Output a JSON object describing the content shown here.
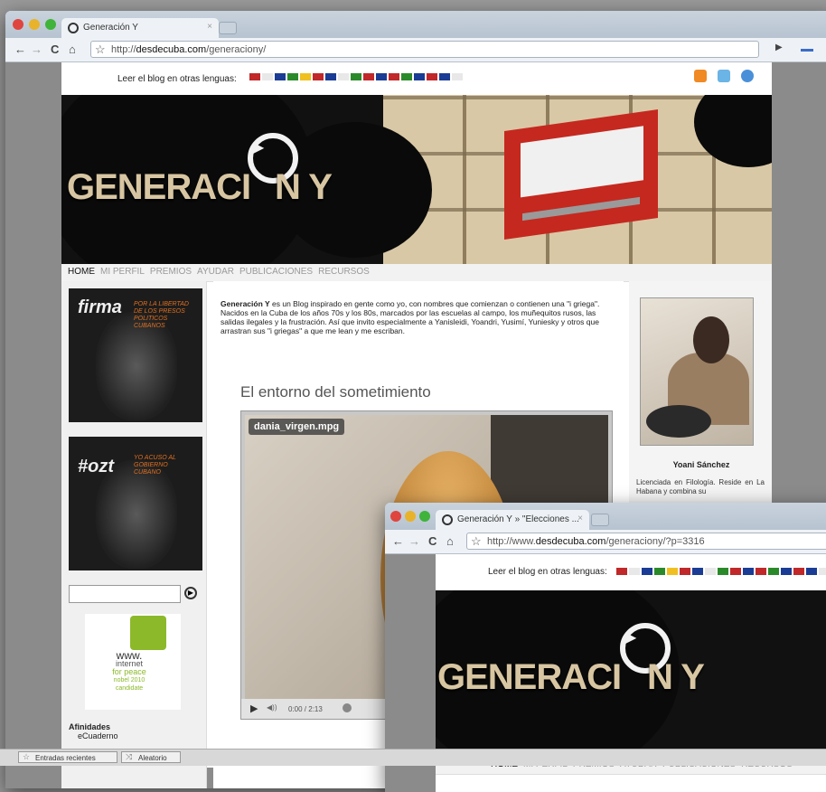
{
  "window1": {
    "tab_title": "Generación Y",
    "tab_close": "×",
    "url_plain": "http://",
    "url_host": "desdecuba.com",
    "url_path": "/generaciony/",
    "nav_back": "←",
    "nav_forward": "→",
    "nav_reload": "C",
    "nav_home": "⌂",
    "go": "▶"
  },
  "site": {
    "lang_label": "Leer el blog en otras lenguas:",
    "flags": [
      "#c0282a",
      "#e8e8e8",
      "#1a3c94",
      "#2a8a2a",
      "#f0c020",
      "#c0282a",
      "#1a3c94",
      "#e8e8e8",
      "#2a8a2a",
      "#c0282a",
      "#1a3c94",
      "#c0282a",
      "#2a8a2a",
      "#1a3c94",
      "#c0282a",
      "#1a3c94",
      "#e8e8e8"
    ],
    "logo_text_a": "GENERACI",
    "logo_text_b": "N Y",
    "nav": [
      "HOME",
      "MI PERFIL",
      "PREMIOS",
      "AYUDAR",
      "PUBLICACIONES",
      "RECURSOS"
    ],
    "campaign1_big": "firma",
    "campaign1_small": "POR LA LIBERTAD DE LOS PRESOS POLITICOS CUBANOS",
    "campaign2_big": "#ozt",
    "campaign2_small": "YO ACUSO AL GOBIERNO CUBANO",
    "peace_www": "www.",
    "peace_line1": "internet",
    "peace_line2": "for peace",
    "peace_line3": "nobel 2010",
    "peace_line4": "candidate",
    "afinidades_title": "Afinidades",
    "afinidades_item": "eCuaderno",
    "intro_bold": "Generación Y",
    "intro_text": " es un Blog inspirado en gente como yo, con nombres que comienzan o contienen una \"i griega\". Nacidos en la Cuba de los años 70s y los 80s, marcados por las escuelas al campo, los muñequitos rusos, las salidas ilegales y la frustración. Así que invito especialmente a Yanisleidi, Yoandri, Yusimí, Yuniesky y otros que arrastran sus \"i griegas\" a que me lean y me escriban.",
    "post_title": "El entorno del sometimiento",
    "video_file": "dania_virgen.mpg",
    "video_time": "0:00 / 2:13",
    "bio_name": "Yoani Sánchez",
    "bio_text": "Licenciada en Filología. Reside en La Habana y combina su"
  },
  "window2": {
    "tab_title": "Generación Y » \"Elecciones ...",
    "tab_close": "×",
    "url_plain": "http://www.",
    "url_host": "desdecuba.com",
    "url_path": "/generaciony/?p=3316",
    "lang_label": "Leer el blog en otras lenguas:",
    "nav": [
      "HOME",
      "MI PERFIL",
      "PREMIOS",
      "AYUDAR",
      "PUBLICACIONES",
      "RECURSOS"
    ]
  },
  "taskbar": {
    "item1": "Entradas recientes",
    "item2": "Aleatorio"
  },
  "colors": {
    "accent_orange": "#e07020",
    "brand_red": "#c5281f",
    "peace_green": "#8cb92a"
  }
}
